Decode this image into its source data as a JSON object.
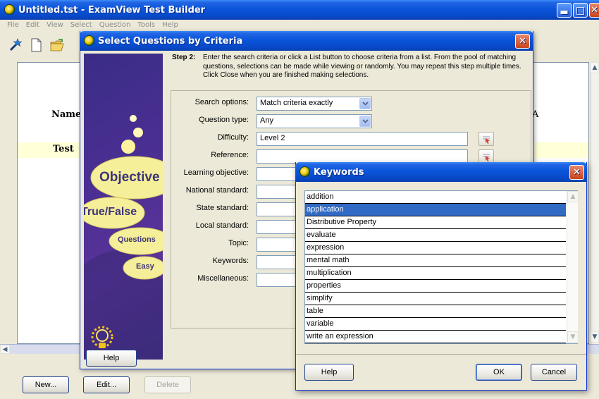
{
  "main_window": {
    "title": "Untitled.tst - ExamView Test Builder",
    "menu": [
      "File",
      "Edit",
      "View",
      "Select",
      "Question",
      "Tools",
      "Help"
    ],
    "toolbar_icons": [
      "wand-icon",
      "new-document-icon",
      "open-folder-icon"
    ],
    "document": {
      "name_label": "Name",
      "test_label": "Test",
      "right_letter": "A"
    },
    "buttons": {
      "new": "New...",
      "edit": "Edit...",
      "delete": "Delete"
    }
  },
  "select_dialog": {
    "title": "Select Questions by Criteria",
    "step_label": "Step 2:",
    "step_text": "Enter the search criteria or click a List button to choose criteria from a list. From the pool of matching questions, selections can be made while viewing or randomly. You may repeat this step multiple times. Click Close when you are finished making selections.",
    "art_labels": {
      "objective": "Objective",
      "true_false": "True/False",
      "questions": "Questions",
      "easy": "Easy"
    },
    "fields": [
      {
        "label": "Search options:",
        "value": "Match criteria exactly",
        "kind": "select"
      },
      {
        "label": "Question type:",
        "value": "Any",
        "kind": "select"
      },
      {
        "label": "Difficulty:",
        "value": "Level 2",
        "kind": "text"
      },
      {
        "label": "Reference:",
        "value": "",
        "kind": "text"
      },
      {
        "label": "Learning objective:",
        "value": "",
        "kind": "text"
      },
      {
        "label": "National standard:",
        "value": "",
        "kind": "text"
      },
      {
        "label": "State standard:",
        "value": "",
        "kind": "text"
      },
      {
        "label": "Local standard:",
        "value": "",
        "kind": "text"
      },
      {
        "label": "Topic:",
        "value": "",
        "kind": "text"
      },
      {
        "label": "Keywords:",
        "value": "",
        "kind": "text"
      },
      {
        "label": "Miscellaneous:",
        "value": "",
        "kind": "text"
      }
    ],
    "help_button": "Help"
  },
  "keywords_dialog": {
    "title": "Keywords",
    "items": [
      "addition",
      "application",
      "Distributive Property",
      "evaluate",
      "expression",
      "mental math",
      "multiplication",
      "properties",
      "simplify",
      "table",
      "variable",
      "write an expression"
    ],
    "selected_index": 1,
    "buttons": {
      "help": "Help",
      "ok": "OK",
      "cancel": "Cancel"
    }
  },
  "colors": {
    "title_bar": "#0a55db",
    "close_button": "#c9441c",
    "selection": "#316ac5",
    "dialog_face": "#ece9d8",
    "art_background": "#4b2f93",
    "art_bubble": "#f6ef9a"
  }
}
